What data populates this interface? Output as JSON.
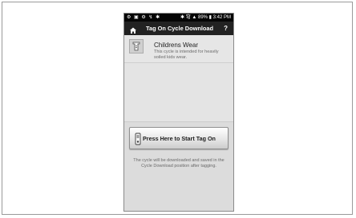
{
  "statusbar": {
    "left_icons": "⚙ ▣ ⚙ ↯ ✱",
    "right_status": "✱ 穹 ▲ 89% ▮ 3:42 PM"
  },
  "header": {
    "home_icon": "home-icon",
    "title": "Tag On Cycle Download",
    "help_label": "?"
  },
  "cycle": {
    "icon": "cycle-icon",
    "name": "Childrens Wear",
    "description": "This cycle is intended for heavily soiled kids wear."
  },
  "action": {
    "start_label": "Press Here to Start Tag On",
    "icon": "tag-icon"
  },
  "footer": {
    "note": "The cycle will be downloaded and saved in the Cycle Download position after tagging."
  }
}
